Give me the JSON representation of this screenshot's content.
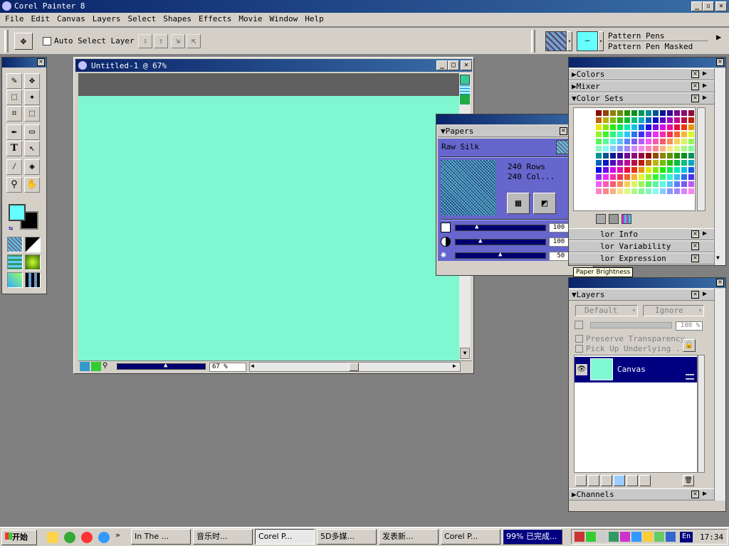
{
  "app": {
    "title": "Corel Painter 8"
  },
  "menu": [
    "File",
    "Edit",
    "Canvas",
    "Layers",
    "Select",
    "Shapes",
    "Effects",
    "Movie",
    "Window",
    "Help"
  ],
  "propbar": {
    "auto_select_label": "Auto Select Layer",
    "brush_category": "Pattern Pens",
    "brush_variant": "Pattern Pen Masked"
  },
  "doc": {
    "title": "Untitled-1 @ 67%",
    "zoom": "67 %",
    "canvas_color": "#7ff7d0"
  },
  "papers": {
    "title": "Papers",
    "paper_name": "Raw Silk",
    "rows": "240 Rows",
    "cols": "240 Col...",
    "scale_pct": "100 %",
    "contrast_pct": "100 %",
    "brightness_pct": "50 %",
    "scale_level": 0.2,
    "contrast_level": 0.25,
    "brightness_level": 0.5
  },
  "tooltip": "Paper Brightness",
  "color_panel": {
    "sections": [
      "Colors",
      "Mixer",
      "Color Sets"
    ],
    "lower_sections": [
      "lor Info",
      "lor Variability",
      "lor Expression"
    ]
  },
  "layers": {
    "title": "Layers",
    "composite_method": "Default",
    "composite_depth": "Ignore",
    "opacity": "100 %",
    "preserve_transparency": "Preserve Transparency",
    "pick_up_underlying": "Pick Up Underlying ...",
    "layer_name": "Canvas",
    "channels": "Channels"
  },
  "taskbar": {
    "start": "开始",
    "tasks": [
      "In The ...",
      "音乐时...",
      "Corel P...",
      "5D多媒...",
      "发表新...",
      "Corel P...",
      "99% 已完成..."
    ],
    "lang": "En",
    "clock": "17:34"
  },
  "colors": {
    "accent": "#0a246a",
    "panel_blue": "#6666cc",
    "canvas": "#7ff7d0",
    "fg_swatch": "#66ffff",
    "bg_swatch": "#000000"
  }
}
